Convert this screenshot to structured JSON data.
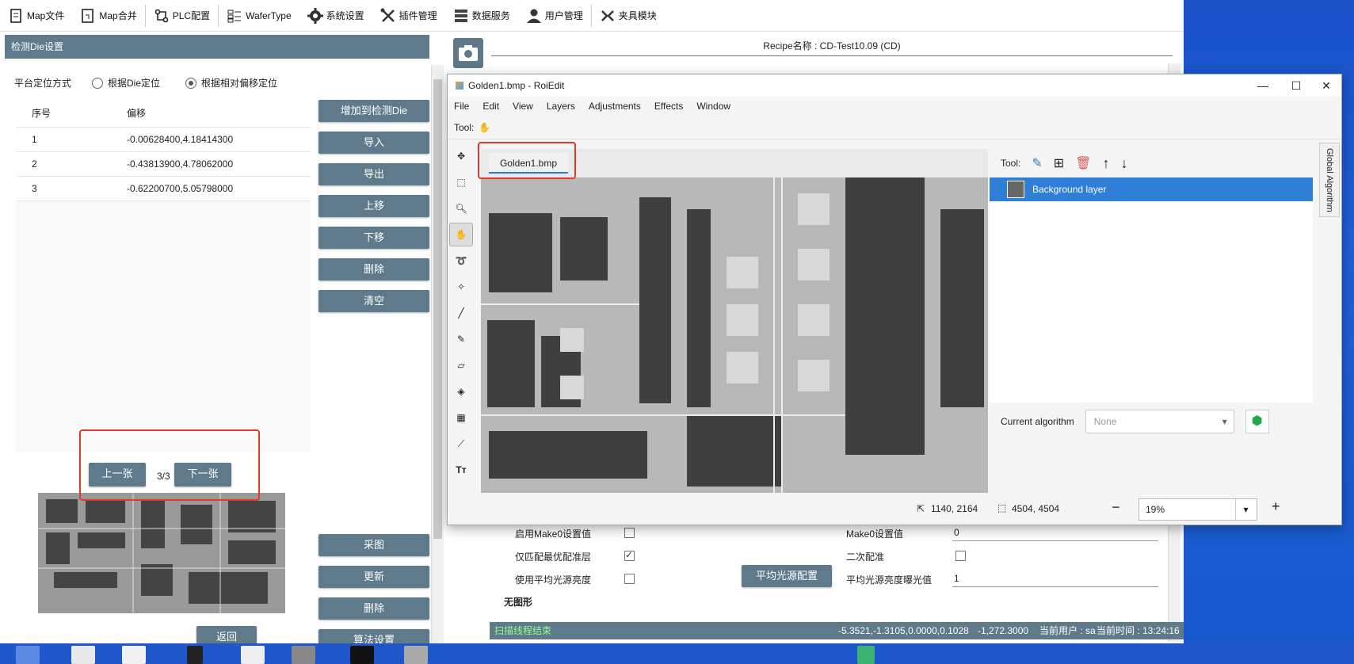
{
  "toolbar": {
    "items": [
      {
        "label": "Map文件",
        "icon": "file-icon"
      },
      {
        "label": "Map合并",
        "icon": "merge-icon"
      },
      {
        "label": "PLC配置",
        "icon": "plc-icon"
      },
      {
        "label": "WaferType",
        "icon": "grid-icon"
      },
      {
        "label": "系统设置",
        "icon": "gear-icon"
      },
      {
        "label": "插件管理",
        "icon": "tools-icon"
      },
      {
        "label": "数据服务",
        "icon": "database-icon"
      },
      {
        "label": "用户管理",
        "icon": "user-icon"
      },
      {
        "label": "夹具模块",
        "icon": "clamp-icon"
      }
    ]
  },
  "left": {
    "header": "检测Die设置",
    "location_label": "平台定位方式",
    "radio_die": "根据Die定位",
    "radio_offset": "根据相对偏移定位",
    "table": {
      "headers": [
        "序号",
        "偏移"
      ],
      "rows": [
        [
          "1",
          "-0.00628400,4.18414300"
        ],
        [
          "2",
          "-0.43813900,4.78062000"
        ],
        [
          "3",
          "-0.62200700,5.05798000"
        ]
      ]
    },
    "buttons": {
      "add": "增加到检测Die",
      "import": "导入",
      "export": "导出",
      "move_up": "上移",
      "move_down": "下移",
      "delete": "删除",
      "clear": "清空",
      "capture": "采图",
      "update": "更新",
      "delete2": "删除",
      "algo": "算法设置",
      "back": "返回"
    },
    "pager": {
      "prev": "上一张",
      "next": "下一张",
      "text": "3/3"
    }
  },
  "right": {
    "recipe": "Recipe名称 : CD-Test10.09 (CD)",
    "form": {
      "make0_enable": "启用Make0设置值",
      "make0_value_label": "Make0设置值",
      "make0_value": "0",
      "match_best": "仅匹配最优配准层",
      "second_match": "二次配准",
      "use_avg_light": "使用平均光源亮度",
      "avg_light_btn": "平均光源配置",
      "avg_light_exposure_label": "平均光源亮度曝光值",
      "avg_light_exposure": "1",
      "no_shape": "无图形"
    },
    "status": {
      "left": "扫描线程结束",
      "coords": "-5.3521,-1.3105,0.0000,0.1028",
      "pos": "-1,272.3000",
      "user": "当前用户 : sa",
      "time": "当前时间 : 13:24:16"
    }
  },
  "roi": {
    "title": "Golden1.bmp - RoiEdit",
    "menu": [
      "File",
      "Edit",
      "View",
      "Layers",
      "Adjustments",
      "Effects",
      "Window"
    ],
    "tool_label": "Tool:",
    "doc_tab": "Golden1.bmp",
    "layers_tool_label": "Tool:",
    "layer_name": "Background layer",
    "current_algorithm_label": "Current algorithm",
    "algorithm_value": "None",
    "global_tab": "Global Algorithm",
    "cursor_pos": "1140, 2164",
    "image_size": "4504, 4504",
    "zoom": "19%"
  },
  "colors": {
    "accent": "#5f7a8a",
    "highlight": "#e03a2a",
    "selection": "#2f7fd8"
  }
}
